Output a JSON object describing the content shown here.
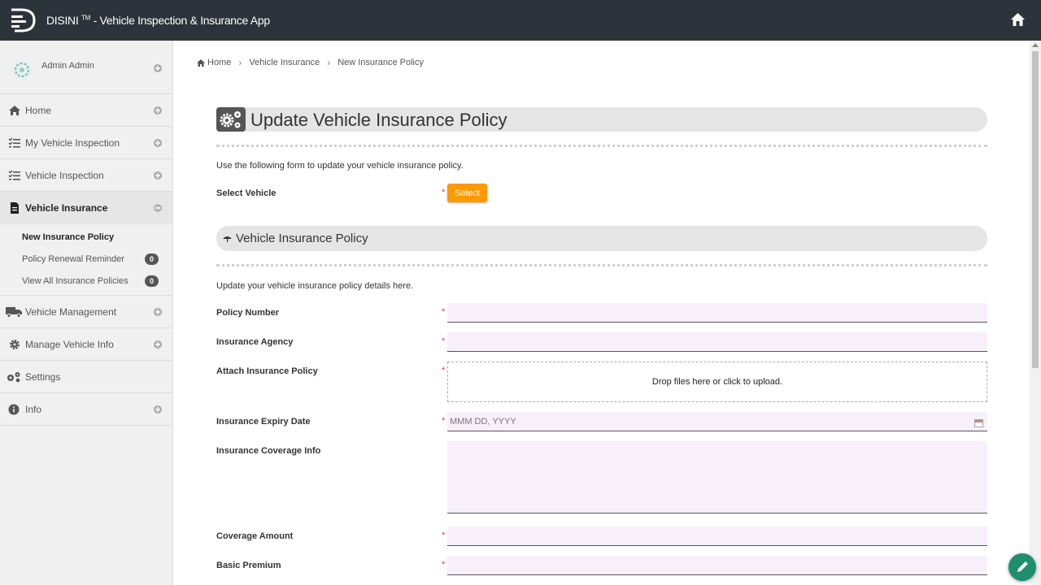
{
  "header": {
    "brand": "DISINI",
    "trademark": "TM",
    "subtitle": " - Vehicle Inspection & Insurance App",
    "icons": [
      "disini-logo-icon",
      "home-icon"
    ]
  },
  "sidebar": {
    "user_name": "Admin Admin",
    "items": [
      {
        "label": "Home",
        "icon": "home-icon"
      },
      {
        "label": "My Vehicle Inspection",
        "icon": "checklist-icon"
      },
      {
        "label": "Vehicle Inspection",
        "icon": "checklist-icon"
      },
      {
        "label": "Vehicle Insurance",
        "icon": "document-icon"
      },
      {
        "label": "Vehicle Management",
        "icon": "truck-icon"
      },
      {
        "label": "Manage Vehicle Info",
        "icon": "gear-icon"
      },
      {
        "label": "Settings",
        "icon": "gears-icon"
      },
      {
        "label": "Info",
        "icon": "info-icon"
      }
    ],
    "sub_items": [
      {
        "label": "New Insurance Policy"
      },
      {
        "label": "Policy Renewal Reminder",
        "badge": "0"
      },
      {
        "label": "View All Insurance Policies",
        "badge": "0"
      }
    ]
  },
  "breadcrumb": [
    "Home",
    "Vehicle Insurance",
    "New Insurance Policy"
  ],
  "page": {
    "title": "Update Vehicle Insurance Policy",
    "intro": "Use the following form to update your vehicle insurance policy.",
    "select_vehicle_label": "Select Vehicle",
    "select_button": "Select",
    "section_title": "Vehicle Insurance Policy",
    "section_intro": "Update your vehicle insurance policy details here.",
    "required_mark": "*"
  },
  "form": {
    "policy_number": {
      "label": "Policy Number",
      "value": ""
    },
    "insurance_agency": {
      "label": "Insurance Agency",
      "value": ""
    },
    "attach_policy": {
      "label": "Attach Insurance Policy",
      "dropzone_text": "Drop files here or click to upload."
    },
    "expiry_date": {
      "label": "Insurance Expiry Date",
      "placeholder": "MMM DD, YYYY"
    },
    "coverage_info": {
      "label": "Insurance Coverage Info",
      "value": ""
    },
    "coverage_amount": {
      "label": "Coverage Amount",
      "value": ""
    },
    "basic_premium": {
      "label": "Basic Premium",
      "value": ""
    }
  },
  "colors": {
    "topbar": "#2c333a",
    "accent_button": "#ff9900",
    "field_bg": "#f7f0fb",
    "fab": "#1f8e6e"
  }
}
